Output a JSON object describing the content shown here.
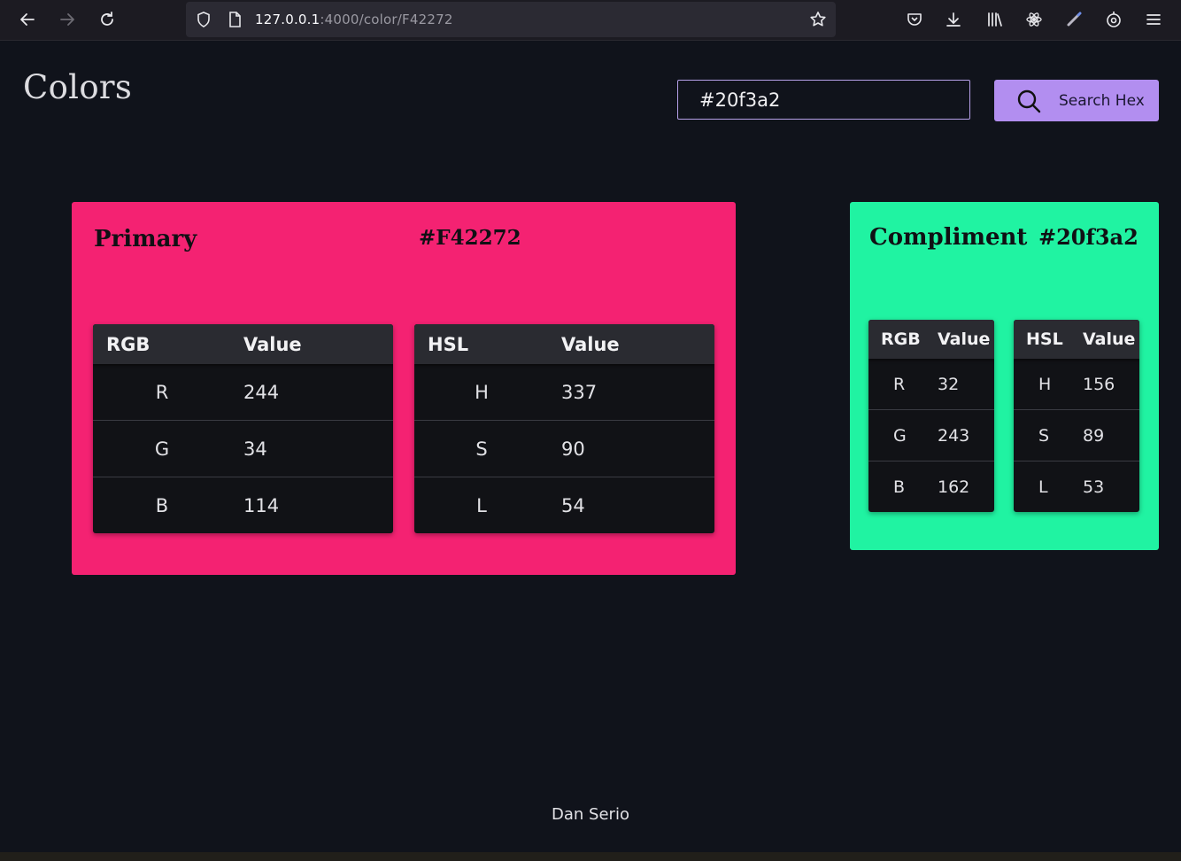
{
  "browser": {
    "url_host": "127.0.0.1",
    "url_path": ":4000/color/F42272"
  },
  "page": {
    "title": "Colors",
    "search": {
      "value": "#20f3a2",
      "button_label": "Search Hex"
    },
    "footer": "Dan Serio"
  },
  "primary": {
    "label": "Primary",
    "hex": "#F42272",
    "color": "#F42272",
    "rgb_table": {
      "headers": [
        "RGB",
        "Value"
      ],
      "rows": [
        [
          "R",
          "244"
        ],
        [
          "G",
          "34"
        ],
        [
          "B",
          "114"
        ]
      ]
    },
    "hsl_table": {
      "headers": [
        "HSL",
        "Value"
      ],
      "rows": [
        [
          "H",
          "337"
        ],
        [
          "S",
          "90"
        ],
        [
          "L",
          "54"
        ]
      ]
    }
  },
  "compliment": {
    "label": "Compliment",
    "hex": "#20f3a2",
    "color": "#20f3a2",
    "rgb_table": {
      "headers": [
        "RGB",
        "Value"
      ],
      "rows": [
        [
          "R",
          "32"
        ],
        [
          "G",
          "243"
        ],
        [
          "B",
          "162"
        ]
      ]
    },
    "hsl_table": {
      "headers": [
        "HSL",
        "Value"
      ],
      "rows": [
        [
          "H",
          "156"
        ],
        [
          "S",
          "89"
        ],
        [
          "L",
          "53"
        ]
      ]
    }
  },
  "icons": [
    "back-icon",
    "forward-icon",
    "reload-icon",
    "shield-icon",
    "page-icon",
    "star-icon",
    "pocket-icon",
    "download-icon",
    "library-icon",
    "react-devtools-icon",
    "brush-icon",
    "extension-icon",
    "menu-icon",
    "search-icon"
  ]
}
